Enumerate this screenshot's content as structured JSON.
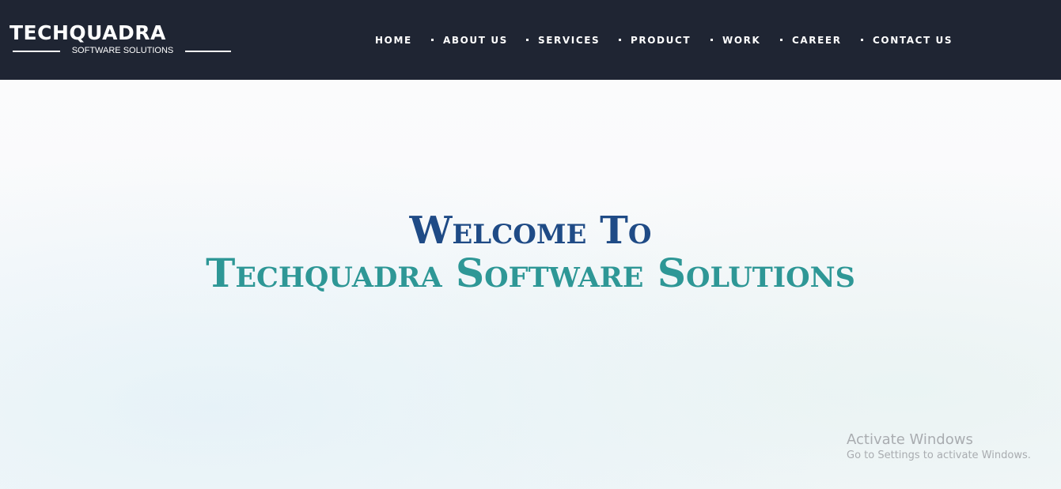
{
  "header": {
    "logo": {
      "main_text": "TECHQUADRA",
      "sub_text": "SOFTWARE SOLUTIONS"
    },
    "nav": [
      {
        "label": "HOME"
      },
      {
        "label": "ABOUT US"
      },
      {
        "label": "SERVICES"
      },
      {
        "label": "PRODUCT"
      },
      {
        "label": "WORK"
      },
      {
        "label": "CAREER"
      },
      {
        "label": "CONTACT US"
      }
    ]
  },
  "hero": {
    "line1": "Welcome To",
    "line2": "Techquadra Software Solutions"
  },
  "watermark": {
    "title": "Activate Windows",
    "subtitle": "Go to Settings to activate Windows."
  },
  "colors": {
    "navbar_bg": "#1f2533",
    "heading_blue": "#1f4b86",
    "heading_teal": "#2e9796"
  }
}
